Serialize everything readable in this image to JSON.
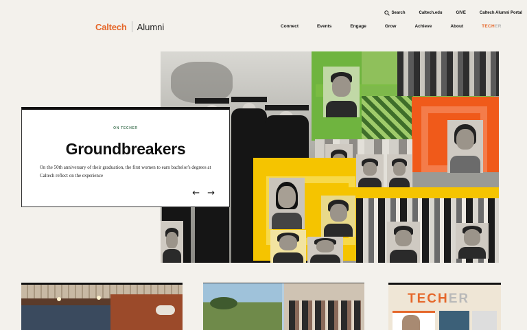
{
  "header": {
    "brand": "Caltech",
    "section": "Alumni",
    "utility": {
      "search": "Search",
      "caltech_edu": "Caltech.edu",
      "give": "GIVE",
      "portal": "Caltech Alumni Portal"
    },
    "nav": {
      "items": [
        "Connect",
        "Events",
        "Engage",
        "Grow",
        "Achieve",
        "About"
      ],
      "techer_prefix": "TECH",
      "techer_suffix": "ER"
    }
  },
  "feature": {
    "eyebrow": "ON TECHER",
    "title": "Groundbreakers",
    "description": "On the 50th anniversary of their graduation, the first women to earn bachelor's degrees at Caltech reflect on the experience",
    "prev_arrow": "←",
    "next_arrow": "→"
  },
  "cards": {
    "techer_prefix": "TECH",
    "techer_suffix": "ER"
  },
  "colors": {
    "accent": "#e5672a",
    "collage_green": "#6fb43f",
    "collage_yellow": "#f5c400",
    "collage_orange": "#f05a1a",
    "card_eyebrow": "#4a7a5c"
  },
  "icons": {
    "search": "search-icon"
  }
}
